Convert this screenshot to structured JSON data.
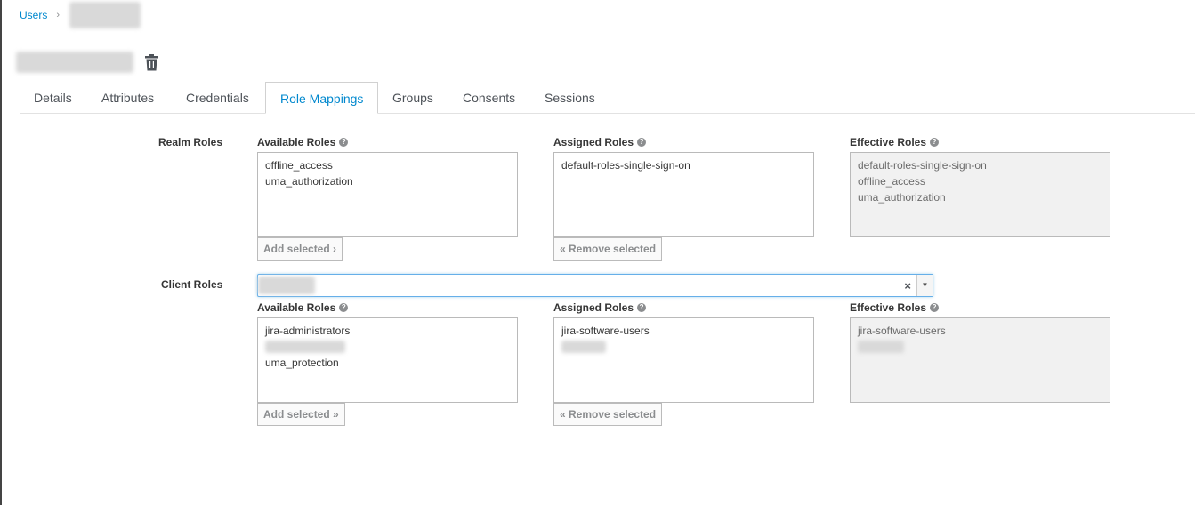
{
  "breadcrumb": {
    "users_label": "Users",
    "separator": "›"
  },
  "tabs": [
    {
      "label": "Details"
    },
    {
      "label": "Attributes"
    },
    {
      "label": "Credentials"
    },
    {
      "label": "Role Mappings",
      "active": true
    },
    {
      "label": "Groups"
    },
    {
      "label": "Consents"
    },
    {
      "label": "Sessions"
    }
  ],
  "realm_roles": {
    "label": "Realm Roles",
    "available": {
      "label": "Available Roles",
      "items": [
        "offline_access",
        "uma_authorization"
      ]
    },
    "assigned": {
      "label": "Assigned Roles",
      "items": [
        "default-roles-single-sign-on"
      ]
    },
    "effective": {
      "label": "Effective Roles",
      "items": [
        "default-roles-single-sign-on",
        "offline_access",
        "uma_authorization"
      ]
    },
    "add_button": "Add selected ›",
    "remove_button": "« Remove selected"
  },
  "client_roles": {
    "label": "Client Roles",
    "select_clear": "×",
    "available": {
      "label": "Available Roles",
      "items": [
        "jira-administrators",
        "",
        "uma_protection"
      ]
    },
    "assigned": {
      "label": "Assigned Roles",
      "items": [
        "jira-software-users",
        ""
      ]
    },
    "effective": {
      "label": "Effective Roles",
      "items": [
        "jira-software-users",
        ""
      ]
    },
    "add_button": "Add selected »",
    "remove_button": "« Remove selected"
  },
  "colors": {
    "accent": "#0088ce",
    "text": "#363636",
    "muted": "#8b8d8f",
    "readonly_bg": "#f1f1f1"
  },
  "icons": {
    "trash": "trash-icon",
    "help": "help-circle-icon"
  }
}
